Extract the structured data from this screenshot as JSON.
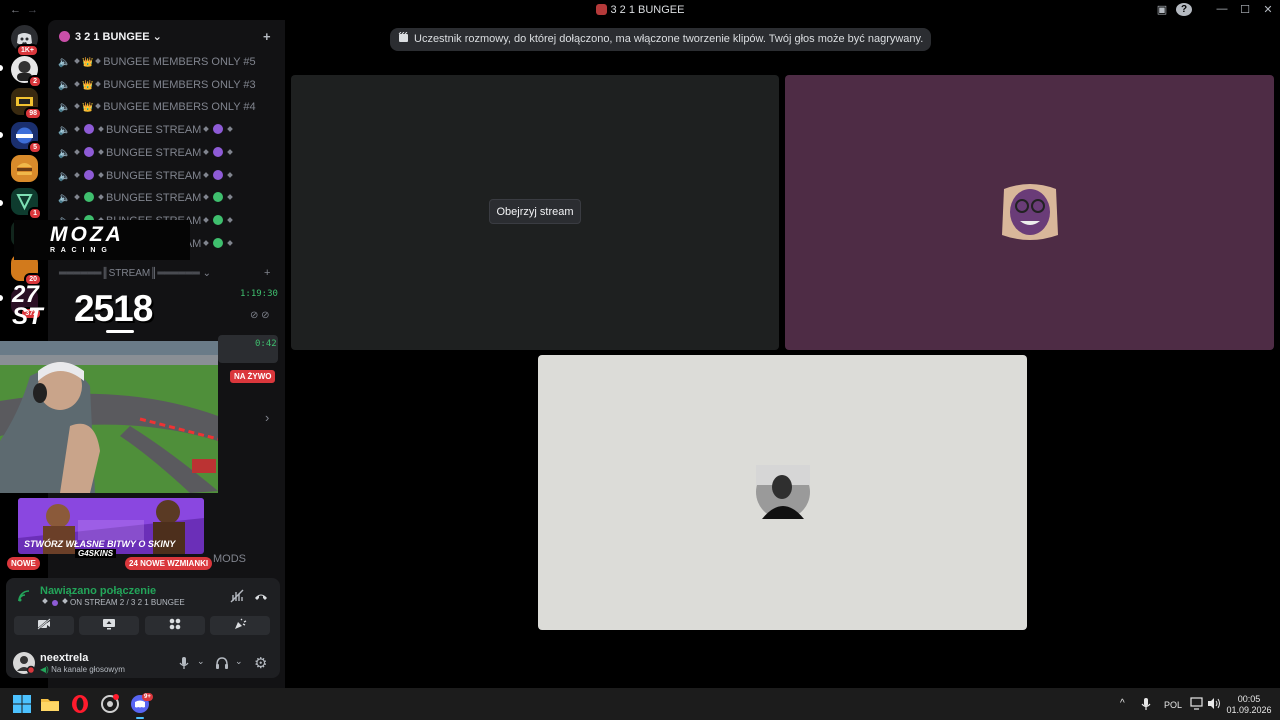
{
  "window": {
    "title": "3 2 1 BUNGEE",
    "back_glyph": "←",
    "forward_glyph": "→",
    "inbox_glyph": "▣",
    "help_glyph": "?",
    "minimize_glyph": "—",
    "maximize_glyph": "☐",
    "close_glyph": "✕"
  },
  "rail": {
    "badges": [
      "1K+",
      "2",
      "98",
      "5",
      "1",
      "26",
      "20",
      "372"
    ]
  },
  "guild": {
    "name": "3 2 1 BUNGEE",
    "chevron": "⌄",
    "add_member_glyph": "+"
  },
  "channels": [
    {
      "name": "BUNGEE MEMBERS ONLY #5",
      "emoji": "👑"
    },
    {
      "name": "BUNGEE MEMBERS ONLY #3",
      "emoji": "👑"
    },
    {
      "name": "BUNGEE MEMBERS ONLY #4",
      "emoji": "👑"
    },
    {
      "name": "BUNGEE STREAM",
      "dot": "#8e5bd6"
    },
    {
      "name": "BUNGEE STREAM",
      "dot": "#8e5bd6"
    },
    {
      "name": "BUNGEE STREAM",
      "dot": "#8e5bd6"
    },
    {
      "name": "BUNGEE STREAM",
      "dot": "#3fbf6e"
    },
    {
      "name": "BUNGEE STREAM",
      "dot": "#3fbf6e"
    },
    {
      "name": "BUNGEE STREAM",
      "dot": "#3fbf6e"
    }
  ],
  "category": {
    "label": "══════║STREAM║══════",
    "chevron": "⌄",
    "add_glyph": "+"
  },
  "overlays": {
    "moza_logo": "MOZA",
    "moza_sub": "R A C I N G",
    "score": "2518",
    "time_1": "1:19:30",
    "time_2": "0:42",
    "live_badge": "NA ŻYWO",
    "promo_text": "STWÓRZ WŁASNE BITWY O SKINY",
    "promo_brand": "G4SKINS",
    "new_badge": "NOWE",
    "mentions_badge": "24 NOWE WZMIANKI",
    "mods_label": "MODS",
    "row_arrow": "›"
  },
  "voice": {
    "status": "Nawiązano połączenie",
    "channel": "ON STREAM 2 / 3 2 1 BUNGEE",
    "hangup_glyph": "☎",
    "buttons": [
      "camera-off",
      "screen-share",
      "activities",
      "soundboard"
    ]
  },
  "user": {
    "name": "neextrela",
    "status": "Na kanale głosowym",
    "mic_glyph": "🎤",
    "headset_glyph": "🎧",
    "settings_glyph": "⚙",
    "chevron": "⌄"
  },
  "notice": {
    "text": "Uczestnik rozmowy, do której dołączono, ma włączone tworzenie klipów. Twój głos może być nagrywany."
  },
  "stage": {
    "watch_button": "Obejrzyj stream",
    "tile_colors": [
      "#1e2020",
      "#4e2c45",
      "#dcdcd8"
    ]
  },
  "taskbar": {
    "tray_chevron": "^",
    "language": "POL",
    "time": "00:05",
    "date": "01.09.2026",
    "discord_badge": "9+"
  },
  "colors": {
    "accent": "#5865f2",
    "danger": "#da373c",
    "connected": "#23a55a"
  }
}
